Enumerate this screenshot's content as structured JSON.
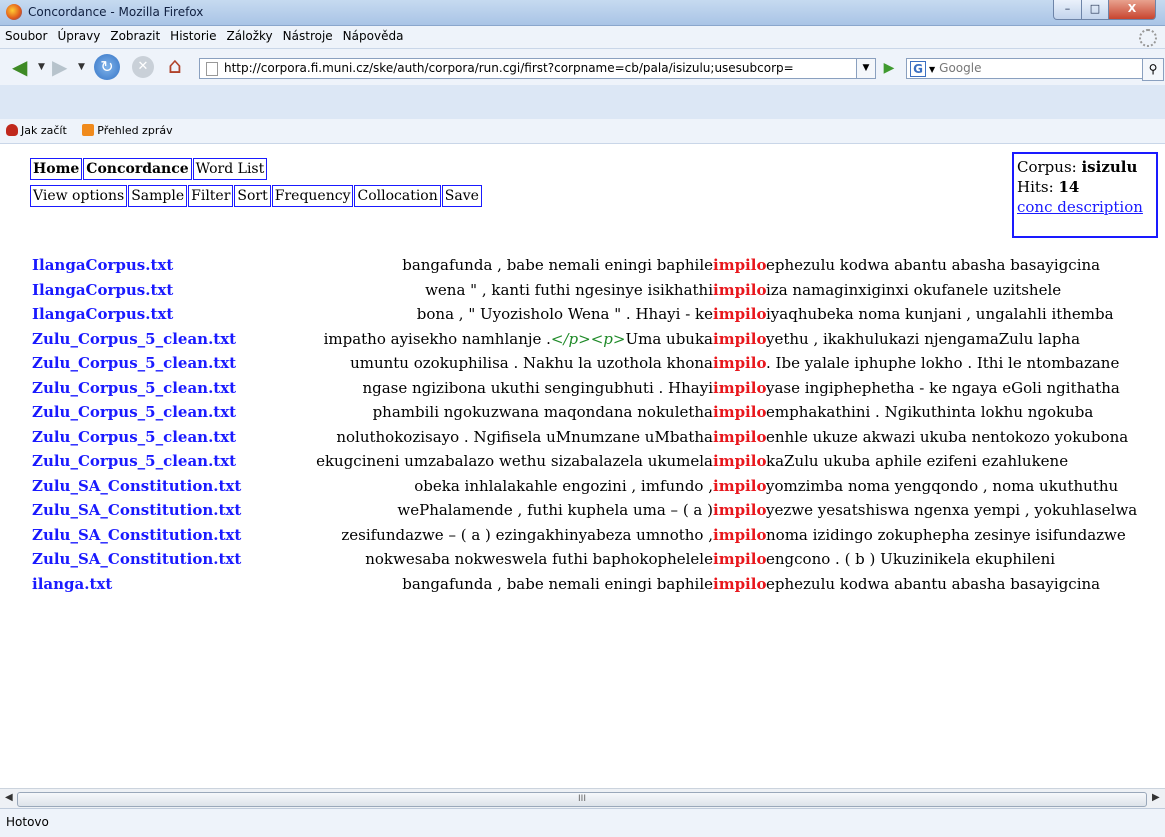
{
  "window": {
    "title": "Concordance - Mozilla Firefox",
    "min": "–",
    "max": "□",
    "close": "X"
  },
  "menu": [
    "Soubor",
    "Úpravy",
    "Zobrazit",
    "Historie",
    "Záložky",
    "Nástroje",
    "Nápověda"
  ],
  "nav": {
    "url": "http://corpora.fi.muni.cz/ske/auth/corpora/run.cgi/first?corpname=cb/pala/isizulu;usesubcorp=",
    "search_placeholder": "Google",
    "search_engine_letter": "G"
  },
  "bookmarks": [
    "Jak začít",
    "Přehled zpráv"
  ],
  "tabs": {
    "row1": [
      "Home",
      "Concordance",
      "Word List"
    ],
    "row2": [
      "View options",
      "Sample",
      "Filter",
      "Sort",
      "Frequency",
      "Collocation",
      "Save"
    ]
  },
  "corpus": {
    "label": "Corpus:",
    "name": "isizulu",
    "hits_label": "Hits:",
    "hits": "14",
    "desc_link": "conc description"
  },
  "concordance": [
    {
      "doc": "IlangaCorpus.txt",
      "left": "bangafunda , babe nemali eningi baphile",
      "kw": "impilo",
      "right": "ephezulu kodwa abantu abasha basayigcina"
    },
    {
      "doc": "IlangaCorpus.txt",
      "left": "wena \" , kanti futhi ngesinye isikhathi",
      "kw": "impilo",
      "right": "iza namaginxiginxi okufanele uzitshele"
    },
    {
      "doc": "IlangaCorpus.txt",
      "left": "bona , \" Uyozisholo Wena \" . Hhayi - ke",
      "kw": "impilo",
      "right": "iyaqhubeka noma kunjani , ungalahli ithemba"
    },
    {
      "doc": "Zulu_Corpus_5_clean.txt",
      "left_a": "impatho ayisekho namhlanje .",
      "left_tag": "</p><p>",
      "left_b": "Uma ubuka",
      "kw": "impilo",
      "right": "yethu , ikakhulukazi njengamaZulu lapha"
    },
    {
      "doc": "Zulu_Corpus_5_clean.txt",
      "left": "umuntu ozokuphilisa . Nakhu la uzothola khona",
      "kw": "impilo",
      "right": ". Ibe yalale iphuphe lokho . Ithi le ntombazane"
    },
    {
      "doc": "Zulu_Corpus_5_clean.txt",
      "left": "ngase ngizibona ukuthi sengingubhuti . Hhayi",
      "kw": "impilo",
      "right": "yase ingiphephetha - ke ngaya eGoli ngithatha"
    },
    {
      "doc": "Zulu_Corpus_5_clean.txt",
      "left": "phambili ngokuzwana maqondana nokuletha",
      "kw": "impilo",
      "right": "emphakathini . Ngikuthinta lokhu ngokuba"
    },
    {
      "doc": "Zulu_Corpus_5_clean.txt",
      "left": "noluthokozisayo . Ngifisela uMnumzane uMbatha",
      "kw": "impilo",
      "right": "enhle ukuze akwazi ukuba nentokozo yokubona"
    },
    {
      "doc": "Zulu_Corpus_5_clean.txt",
      "left": "ekugcineni umzabalazo wethu sizabalazela ukumela",
      "kw": "impilo",
      "right": "kaZulu ukuba aphile ezifeni ezahlukene"
    },
    {
      "doc": "Zulu_SA_Constitution.txt",
      "left": "obeka inhlalakahle engozini , imfundo ,",
      "kw": "impilo",
      "right": "yomzimba noma yengqondo , noma ukuthuthu"
    },
    {
      "doc": "Zulu_SA_Constitution.txt",
      "left": "wePhalamende , futhi kuphela uma – ( a )",
      "kw": "impilo",
      "right": "yezwe yesatshiswa ngenxa yempi , yokuhlaselwa"
    },
    {
      "doc": "Zulu_SA_Constitution.txt",
      "left": "zesifundazwe – ( a ) ezingakhinyabeza umnotho ,",
      "kw": "impilo",
      "right": "noma izidingo zokuphepha zesinye isifundazwe"
    },
    {
      "doc": "Zulu_SA_Constitution.txt",
      "left": "nokwesaba nokweswela futhi baphokophelele",
      "kw": "impilo",
      "right": "engcono . ( b ) Ukuzinikela ekuphileni"
    },
    {
      "doc": "ilanga.txt",
      "left": "bangafunda , babe nemali eningi baphile",
      "kw": "impilo",
      "right": "ephezulu kodwa abantu abasha basayigcina"
    }
  ],
  "scroll": {
    "thumb_grip": "III"
  },
  "status": "Hotovo",
  "colors": {
    "link": "#1a1aff",
    "keyword": "#e8161c",
    "tag": "#1f8a28"
  }
}
